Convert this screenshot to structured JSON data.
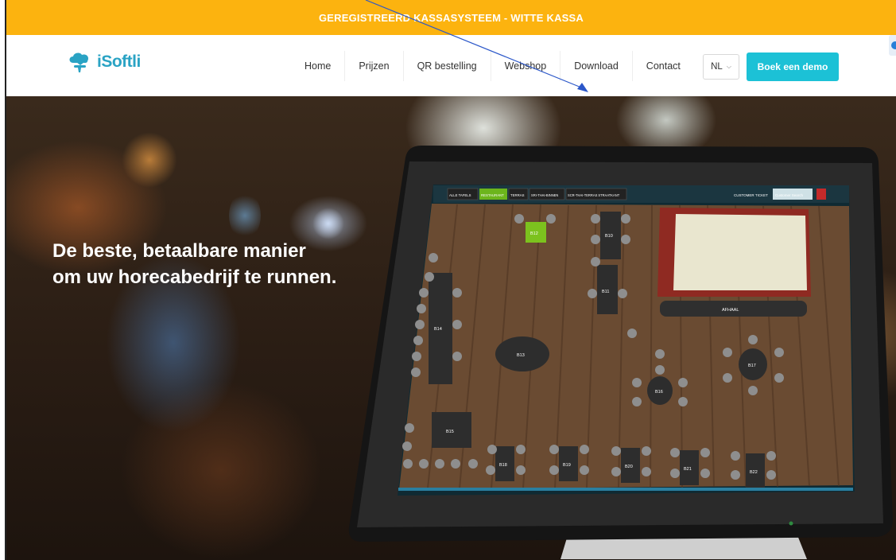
{
  "topbar": {
    "text": "GEREGISTREERD KASSASYSTEEM - WITTE KASSA"
  },
  "brand": {
    "name": "iSoftli",
    "color": "#2aa3c4"
  },
  "nav": {
    "items": [
      {
        "label": "Home"
      },
      {
        "label": "Prijzen"
      },
      {
        "label": "QR bestelling"
      },
      {
        "label": "Webshop"
      },
      {
        "label": "Download"
      },
      {
        "label": "Contact"
      }
    ],
    "language": "NL",
    "demo_button": "Boek een demo"
  },
  "hero": {
    "line1": "De beste, betaalbare manier",
    "line2": "om uw horecabedrijf te runnen."
  },
  "pos_screen": {
    "tabs": [
      "ALLE TAFELS",
      "RESTAURANT",
      "TERRAS",
      "SRI-THAI-BINNEN",
      "SCR-THAI-TERRAS STRAATKANT"
    ],
    "active_tab": "RESTAURANT",
    "customer_ticket": "CUSTOMER TICKET",
    "customer_search_placeholder": "Customer Search",
    "takeaway_label": "AFHAAL",
    "tables": [
      "B10",
      "B11",
      "B12",
      "B13",
      "B14",
      "B15",
      "B16",
      "B17",
      "B18",
      "B19",
      "B20",
      "B21",
      "B22"
    ]
  },
  "colors": {
    "topbar": "#fcb30f",
    "demo_button": "#1cc1d6",
    "active_table": "#7cc21e"
  }
}
